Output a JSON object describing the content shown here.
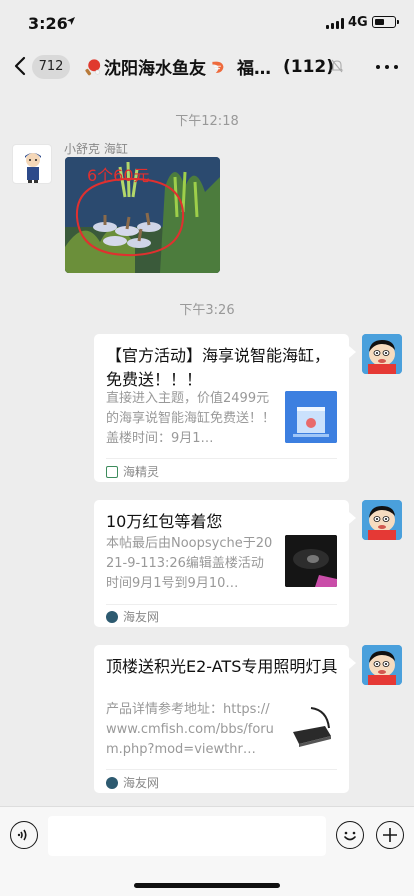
{
  "status_bar": {
    "time": "3:26",
    "location_icon": "location-arrow-icon",
    "network": "4G",
    "battery": 0.5
  },
  "header": {
    "unread_count": "712",
    "title": "沈阳海水鱼友",
    "title_suffix": "福…",
    "member_count": "(112)",
    "leading_emoji": "ping-pong-icon",
    "trailing_emoji": "shrimp-icon"
  },
  "messages": {
    "timestamp1": "下午12:18",
    "sender_name": "小舒克 海缸",
    "photo_caption": "6个60元",
    "timestamp2": "下午3:26",
    "cards": [
      {
        "title": "【官方活动】海享说智能海缸，免费送！！！",
        "description": "直接进入主题，价值2499元的海享说智能海缸免费送！！ 盖楼时间：9月1…",
        "source": "海精灵"
      },
      {
        "title": "10万红包等着您",
        "description": "本帖最后由Noopsyche于2021-9-113:26编辑盖楼活动时间9月1号到9月10…",
        "source": "海友网"
      },
      {
        "title": "顶楼送积光E2-ATS专用照明灯具",
        "description": "产品详情参考地址：https://www.cmfish.com/bbs/forum.php?mod=viewthr…",
        "source": "海友网"
      }
    ]
  },
  "colors": {
    "background": "#ededed",
    "card": "#ffffff",
    "muted_text": "#999999",
    "link_source": "#3d8c5c"
  }
}
